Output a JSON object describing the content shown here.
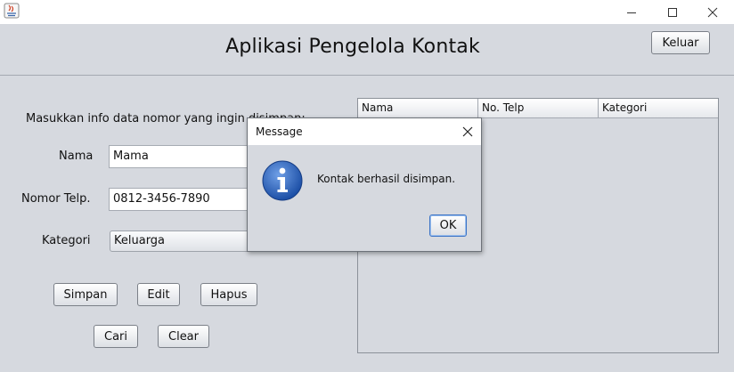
{
  "window": {
    "title": "",
    "icon": "java-icon",
    "controls": [
      "minimize-icon",
      "maximize-icon",
      "close-icon"
    ]
  },
  "header": {
    "title": "Aplikasi Pengelola Kontak",
    "exit_button": "Keluar"
  },
  "form": {
    "instruction": "Masukkan info data nomor yang ingin disimpan:",
    "name_label": "Nama",
    "name_value": "Mama",
    "phone_label": "Nomor Telp.",
    "phone_value": "0812-3456-7890",
    "category_label": "Kategori",
    "category_value": "Keluarga"
  },
  "buttons": {
    "save": "Simpan",
    "edit": "Edit",
    "delete": "Hapus",
    "search": "Cari",
    "clear": "Clear"
  },
  "table": {
    "columns": [
      "Nama",
      "No. Telp",
      "Kategori"
    ],
    "rows": []
  },
  "dialog": {
    "title": "Message",
    "message": "Kontak berhasil disimpan.",
    "ok_button": "OK",
    "icon": "information-icon"
  }
}
